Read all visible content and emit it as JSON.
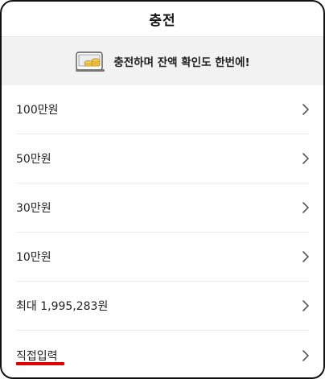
{
  "header": {
    "title": "충전"
  },
  "banner": {
    "icon": "wallet-coins-icon",
    "text": "충전하며 잔액 확인도 한번에!"
  },
  "options": [
    {
      "label": "100만원",
      "icon": "chevron-right-icon"
    },
    {
      "label": "50만원",
      "icon": "chevron-right-icon"
    },
    {
      "label": "30만원",
      "icon": "chevron-right-icon"
    },
    {
      "label": "10만원",
      "icon": "chevron-right-icon"
    },
    {
      "label": "최대 1,995,283원",
      "icon": "chevron-right-icon"
    },
    {
      "label": "직접입력",
      "icon": "chevron-right-icon"
    }
  ],
  "colors": {
    "highlight": "#e00000",
    "banner_bg": "#f2f2f2"
  }
}
